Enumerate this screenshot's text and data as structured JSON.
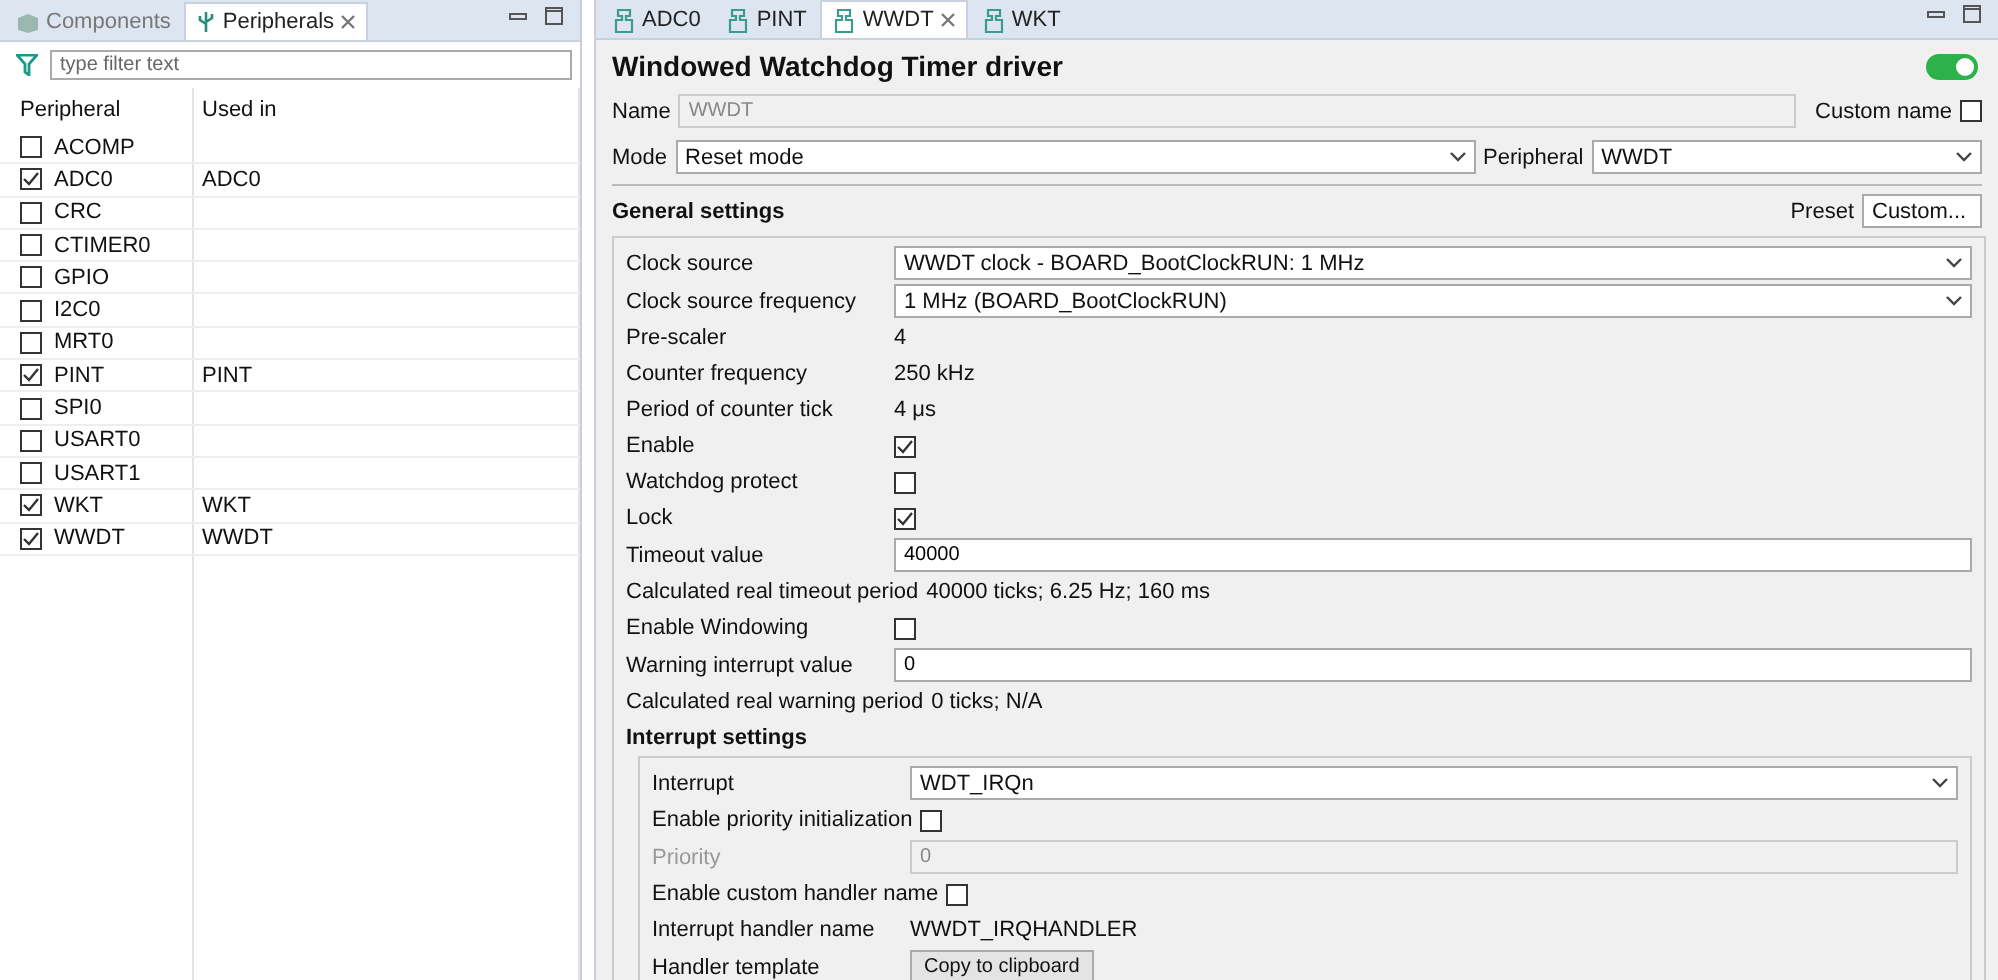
{
  "left_panel": {
    "tabs": [
      {
        "label": "Components",
        "selected": false
      },
      {
        "label": "Peripherals",
        "selected": true,
        "closable": true
      }
    ],
    "filter": {
      "placeholder": "type filter text"
    },
    "columns": [
      "Peripheral",
      "Used in"
    ],
    "rows": [
      {
        "name": "ACOMP",
        "checked": false,
        "used_in": ""
      },
      {
        "name": "ADC0",
        "checked": true,
        "used_in": "ADC0"
      },
      {
        "name": "CRC",
        "checked": false,
        "used_in": ""
      },
      {
        "name": "CTIMER0",
        "checked": false,
        "used_in": ""
      },
      {
        "name": "GPIO",
        "checked": false,
        "used_in": ""
      },
      {
        "name": "I2C0",
        "checked": false,
        "used_in": ""
      },
      {
        "name": "MRT0",
        "checked": false,
        "used_in": ""
      },
      {
        "name": "PINT",
        "checked": true,
        "used_in": "PINT"
      },
      {
        "name": "SPI0",
        "checked": false,
        "used_in": ""
      },
      {
        "name": "USART0",
        "checked": false,
        "used_in": ""
      },
      {
        "name": "USART1",
        "checked": false,
        "used_in": ""
      },
      {
        "name": "WKT",
        "checked": true,
        "used_in": "WKT"
      },
      {
        "name": "WWDT",
        "checked": true,
        "used_in": "WWDT"
      }
    ]
  },
  "editor": {
    "tabs": [
      {
        "label": "ADC0",
        "selected": false
      },
      {
        "label": "PINT",
        "selected": false
      },
      {
        "label": "WWDT",
        "selected": true,
        "closable": true
      },
      {
        "label": "WKT",
        "selected": false
      }
    ],
    "title": "Windowed Watchdog Timer driver",
    "enabled": true,
    "name": {
      "label": "Name",
      "value": "WWDT",
      "disabled": true
    },
    "custom_name": {
      "label": "Custom name",
      "checked": false
    },
    "mode": {
      "label": "Mode",
      "value": "Reset mode"
    },
    "peripheral": {
      "label": "Peripheral",
      "value": "WWDT"
    },
    "general_settings": {
      "title": "General settings",
      "preset_label": "Preset",
      "preset_value": "Custom...",
      "rows": [
        {
          "kind": "select",
          "label": "Clock source",
          "value": "WWDT clock - BOARD_BootClockRUN: 1 MHz"
        },
        {
          "kind": "select",
          "label": "Clock source frequency",
          "value": "1 MHz (BOARD_BootClockRUN)"
        },
        {
          "kind": "text",
          "label": "Pre-scaler",
          "value": "4"
        },
        {
          "kind": "text",
          "label": "Counter frequency",
          "value": "250 kHz"
        },
        {
          "kind": "text",
          "label": "Period of counter tick",
          "value": "4 μs"
        },
        {
          "kind": "checkbox",
          "label": "Enable",
          "checked": true
        },
        {
          "kind": "checkbox",
          "label": "Watchdog protect",
          "checked": false
        },
        {
          "kind": "checkbox",
          "label": "Lock",
          "checked": true
        },
        {
          "kind": "input",
          "label": "Timeout value",
          "value": "40000"
        },
        {
          "kind": "text",
          "label": "Calculated real timeout period",
          "value": "40000 ticks; 6.25 Hz; 160 ms"
        },
        {
          "kind": "checkbox",
          "label": "Enable Windowing",
          "checked": false
        },
        {
          "kind": "input",
          "label": "Warning interrupt value",
          "value": "0"
        },
        {
          "kind": "text",
          "label": "Calculated real warning period",
          "value": "0 ticks; N/A"
        }
      ]
    },
    "interrupt_settings": {
      "title": "Interrupt settings",
      "rows": [
        {
          "kind": "select",
          "label": "Interrupt",
          "value": "WDT_IRQn"
        },
        {
          "kind": "checkbox",
          "label": "Enable priority initialization",
          "checked": false
        },
        {
          "kind": "input",
          "label": "Priority",
          "value": "0",
          "disabled": true
        },
        {
          "kind": "checkbox",
          "label": "Enable custom handler name",
          "checked": false
        },
        {
          "kind": "text",
          "label": "Interrupt handler name",
          "value": "WWDT_IRQHANDLER"
        },
        {
          "kind": "button",
          "label": "Handler template",
          "value": "Copy to clipboard"
        }
      ]
    }
  }
}
